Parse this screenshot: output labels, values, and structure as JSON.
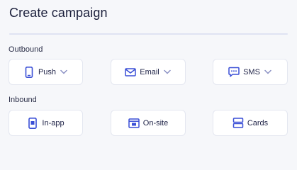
{
  "header": {
    "title": "Create campaign"
  },
  "sections": {
    "outbound": {
      "label": "Outbound",
      "items": [
        {
          "label": "Push",
          "icon": "phone-icon",
          "has_dropdown": true
        },
        {
          "label": "Email",
          "icon": "envelope-icon",
          "has_dropdown": true
        },
        {
          "label": "SMS",
          "icon": "message-icon",
          "has_dropdown": true
        }
      ]
    },
    "inbound": {
      "label": "Inbound",
      "items": [
        {
          "label": "In-app",
          "icon": "in-app-icon"
        },
        {
          "label": "On-site",
          "icon": "browser-window-icon"
        },
        {
          "label": "Cards",
          "icon": "cards-icon"
        }
      ]
    }
  },
  "colors": {
    "accent": "#3a4fd6",
    "text": "#1b1f3b",
    "background": "#f6f7fa",
    "divider": "#dfe3f3"
  }
}
